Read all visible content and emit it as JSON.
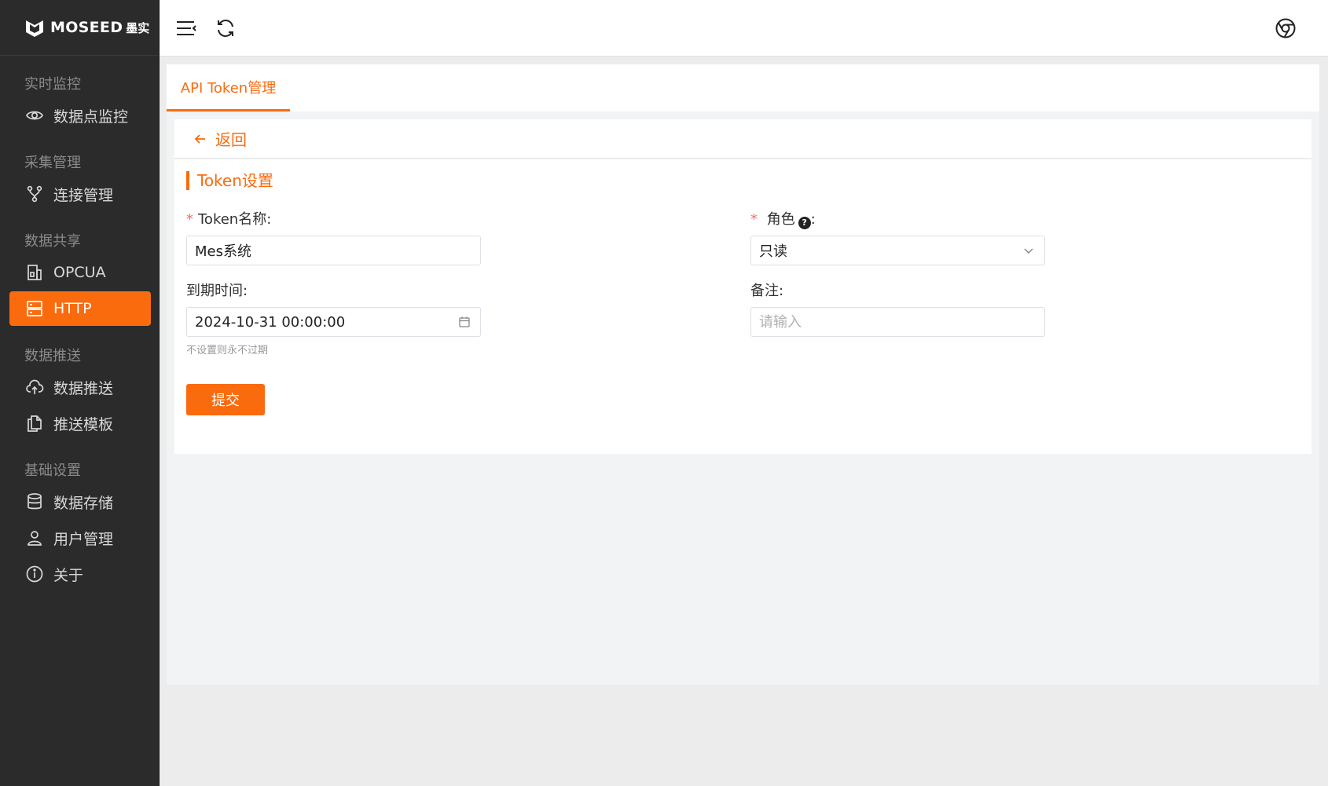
{
  "brand": {
    "name": "MOSEED",
    "sub": "墨实"
  },
  "sidebar": {
    "groups": [
      {
        "title": "实时监控",
        "items": [
          {
            "label": "数据点监控",
            "icon": "eye-icon"
          }
        ]
      },
      {
        "title": "采集管理",
        "items": [
          {
            "label": "连接管理",
            "icon": "branch-icon"
          }
        ]
      },
      {
        "title": "数据共享",
        "items": [
          {
            "label": "OPCUA",
            "icon": "building-icon"
          },
          {
            "label": "HTTP",
            "icon": "server-icon",
            "active": true
          }
        ]
      },
      {
        "title": "数据推送",
        "items": [
          {
            "label": "数据推送",
            "icon": "cloud-upload-icon"
          },
          {
            "label": "推送模板",
            "icon": "copy-icon"
          }
        ]
      },
      {
        "title": "基础设置",
        "items": [
          {
            "label": "数据存储",
            "icon": "database-icon"
          },
          {
            "label": "用户管理",
            "icon": "user-icon"
          },
          {
            "label": "关于",
            "icon": "info-icon"
          }
        ]
      }
    ]
  },
  "tabs": [
    {
      "label": "API Token管理",
      "active": true
    }
  ],
  "back": {
    "label": "返回"
  },
  "form": {
    "section_title": "Token设置",
    "token_name": {
      "label": "Token名称:",
      "value": "Mes系统",
      "required": true
    },
    "role": {
      "label": "角色",
      "colon": ":",
      "value": "只读",
      "required": true,
      "help": "?"
    },
    "expire": {
      "label": "到期时间:",
      "value": "2024-10-31 00:00:00",
      "hint": "不设置则永不过期"
    },
    "remark": {
      "label": "备注:",
      "placeholder": "请输入",
      "value": ""
    },
    "submit_label": "提交"
  },
  "colors": {
    "accent": "#fa6b0e",
    "sidebar_bg": "#2b2b2b"
  }
}
